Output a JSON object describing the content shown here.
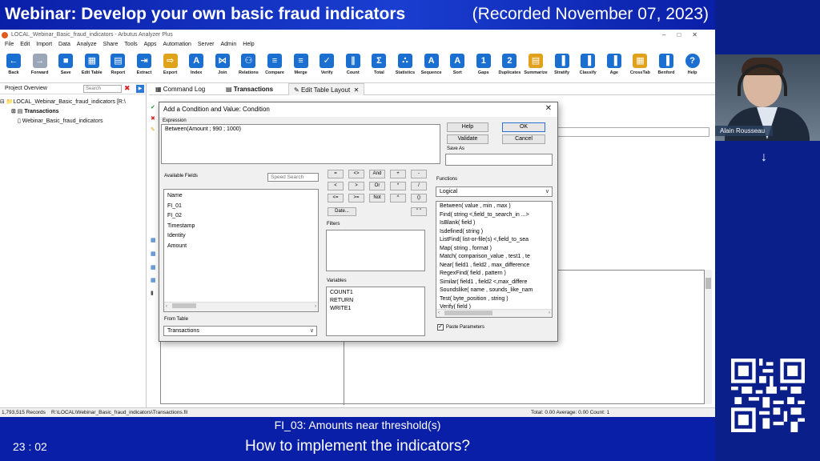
{
  "webinar": {
    "title": "Webinar: Develop your own basic fraud indicators",
    "recorded": "(Recorded November 07, 2023)",
    "caption": "FI_03: Amounts near threshold(s)",
    "time": "23 : 02",
    "question": "How to implement the indicators?",
    "presenter": "Alain Rousseau"
  },
  "app": {
    "title": "LOCAL_Webinar_Basic_fraud_indicators - Arbutus Analyzer Plus",
    "menu": [
      "File",
      "Edit",
      "Import",
      "Data",
      "Analyze",
      "Share",
      "Tools",
      "Apps",
      "Automation",
      "Server",
      "Admin",
      "Help"
    ],
    "toolbar": [
      {
        "label": "Back",
        "icon": "arrow-left-icon",
        "color": "#1a6fd1"
      },
      {
        "label": "Forward",
        "icon": "arrow-right-icon",
        "color": "#9aa7b8"
      },
      {
        "label": "Save",
        "icon": "save-icon",
        "color": "#1a6fd1"
      },
      {
        "label": "Edit Table",
        "icon": "table-icon",
        "color": "#1a6fd1"
      },
      {
        "label": "Report",
        "icon": "report-icon",
        "color": "#1a6fd1"
      },
      {
        "label": "Extract",
        "icon": "extract-icon",
        "color": "#1a6fd1"
      },
      {
        "label": "Export",
        "icon": "export-icon",
        "color": "#e0a21b"
      },
      {
        "label": "Index",
        "icon": "index-icon",
        "color": "#1a6fd1"
      },
      {
        "label": "Join",
        "icon": "join-icon",
        "color": "#1a6fd1"
      },
      {
        "label": "Relations",
        "icon": "relations-icon",
        "color": "#1a6fd1"
      },
      {
        "label": "Compare",
        "icon": "compare-icon",
        "color": "#1a6fd1"
      },
      {
        "label": "Merge",
        "icon": "merge-icon",
        "color": "#1a6fd1"
      },
      {
        "label": "Verify",
        "icon": "verify-icon",
        "color": "#1a6fd1"
      },
      {
        "label": "Count",
        "icon": "count-icon",
        "color": "#1a6fd1"
      },
      {
        "label": "Total",
        "icon": "sigma-icon",
        "color": "#1a6fd1"
      },
      {
        "label": "Statistics",
        "icon": "statistics-icon",
        "color": "#1a6fd1"
      },
      {
        "label": "Sequence",
        "icon": "sequence-icon",
        "color": "#1a6fd1"
      },
      {
        "label": "Sort",
        "icon": "sort-icon",
        "color": "#1a6fd1"
      },
      {
        "label": "Gaps",
        "icon": "gaps-icon",
        "color": "#1a6fd1"
      },
      {
        "label": "Duplicates",
        "icon": "duplicates-icon",
        "color": "#1a6fd1"
      },
      {
        "label": "Summarize",
        "icon": "summarize-icon",
        "color": "#e0a21b"
      },
      {
        "label": "Stratify",
        "icon": "stratify-icon",
        "color": "#1a6fd1"
      },
      {
        "label": "Classify",
        "icon": "classify-icon",
        "color": "#1a6fd1"
      },
      {
        "label": "Age",
        "icon": "age-icon",
        "color": "#1a6fd1"
      },
      {
        "label": "CrossTab",
        "icon": "crosstab-icon",
        "color": "#e0a21b"
      },
      {
        "label": "Benford",
        "icon": "benford-icon",
        "color": "#1a6fd1"
      },
      {
        "label": "Help",
        "icon": "help-icon",
        "color": "#1a6fd1"
      }
    ],
    "project": {
      "header": "Project Overview",
      "search_placeholder": "Search",
      "tree": [
        "LOCAL_Webinar_Basic_fraud_indicators [R:\\",
        "Transactions",
        "Webinar_Basic_fraud_indicators"
      ]
    },
    "tabs": [
      "Command Log",
      "Transactions",
      "Edit Table Layout"
    ],
    "status": {
      "records": "1,793,515 Records",
      "path": "R:\\LOCAL\\Webinar_Basic_fraud_indicators\\Transactions.fil",
      "totals": "Total: 0.00  Average: 0.00  Count: 1"
    }
  },
  "dialog": {
    "title": "Add a Condition and Value: Condition",
    "expression_label": "Expression",
    "expression": "Between(Amount  ; 990 ; 1000)",
    "buttons": {
      "help": "Help",
      "validate": "Validate",
      "ok": "OK",
      "cancel": "Cancel"
    },
    "save_as_label": "Save As",
    "available_fields_label": "Available Fields",
    "speed_search": "Speed Search",
    "fields": [
      "Name",
      "FI_01",
      "FI_02",
      "Timestamp",
      "Identity",
      "Amount"
    ],
    "operators": [
      "=",
      "<>",
      "And",
      "+",
      "-",
      "<",
      ">",
      "Or",
      "*",
      "/",
      "<=",
      ">=",
      "Not",
      "^",
      "()"
    ],
    "date_button": "Date...",
    "quote_button": "\" \"",
    "filters_label": "Filters",
    "variables_label": "Variables",
    "variables": [
      "COUNT1",
      "RETURN",
      "WRITE1"
    ],
    "from_table_label": "From Table",
    "from_table": "Transactions",
    "functions_label": "Functions",
    "function_category": "Logical",
    "functions": [
      "Between( value , min , max )",
      "Find( string <,field_to_search_in ...>",
      "IsBlank( field )",
      "Isdefined( string )",
      "ListFind( list-or-file(s) <,field_to_sea",
      "Map( string , format )",
      "Match( comparison_value , test1 , te",
      "Near( field1 , field2 , max_difference",
      "RegexFind( field , pattern )",
      "Similar( field1 , field2 <,max_differe",
      "Soundslike( name , sounds_like_nam",
      "Test( byte_position , string )",
      "Verify( field )"
    ],
    "paste_parameters": "Paste Parameters",
    "paste_checked": true
  }
}
